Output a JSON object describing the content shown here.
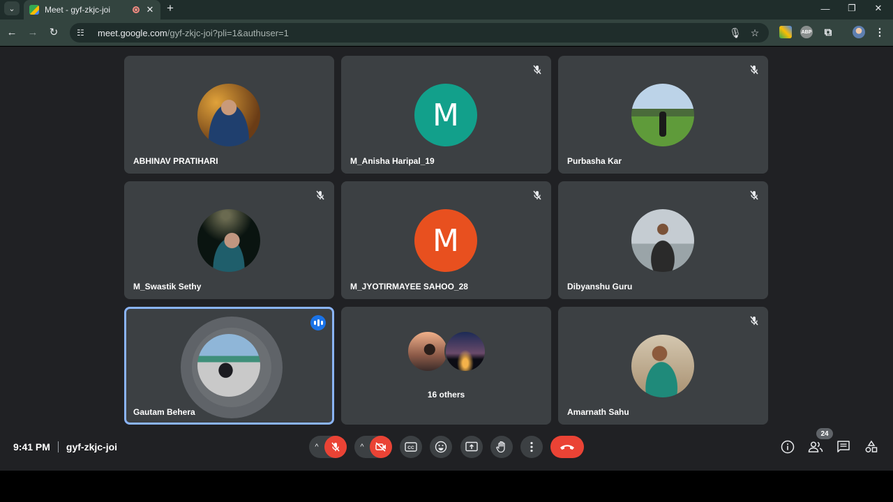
{
  "browser": {
    "tab_title": "Meet - gyf-zkjc-joi",
    "url_host": "meet.google.com",
    "url_path": "/gyf-zkjc-joi?pli=1&authuser=1",
    "extensions": [
      "colorful-extension-icon",
      "ABP",
      "puzzle-icon"
    ],
    "abp_label": "ABP"
  },
  "participants": [
    {
      "name": "ABHINAV PRATIHARI",
      "muted": false,
      "avatar": "photo"
    },
    {
      "name": "M_Anisha Haripal_19",
      "muted": true,
      "avatar": "letter",
      "letter": "M",
      "color": "#12a08b"
    },
    {
      "name": "Purbasha Kar",
      "muted": true,
      "avatar": "photo"
    },
    {
      "name": "M_Swastik Sethy",
      "muted": true,
      "avatar": "photo"
    },
    {
      "name": "M_JYOTIRMAYEE SAHOO_28",
      "muted": true,
      "avatar": "letter",
      "letter": "M",
      "color": "#e8501f"
    },
    {
      "name": "Dibyanshu Guru",
      "muted": true,
      "avatar": "photo"
    },
    {
      "name": "Gautam Behera",
      "muted": false,
      "speaking": true,
      "avatar": "photo"
    },
    {
      "name": "16 others",
      "type": "others"
    },
    {
      "name": "Amarnath Sahu",
      "muted": true,
      "avatar": "photo"
    }
  ],
  "bottom_bar": {
    "time": "9:41 PM",
    "meeting_code": "gyf-zkjc-joi",
    "participant_count": "24",
    "accent_red": "#ea4335",
    "speaking_border": "#8ab4f8"
  }
}
